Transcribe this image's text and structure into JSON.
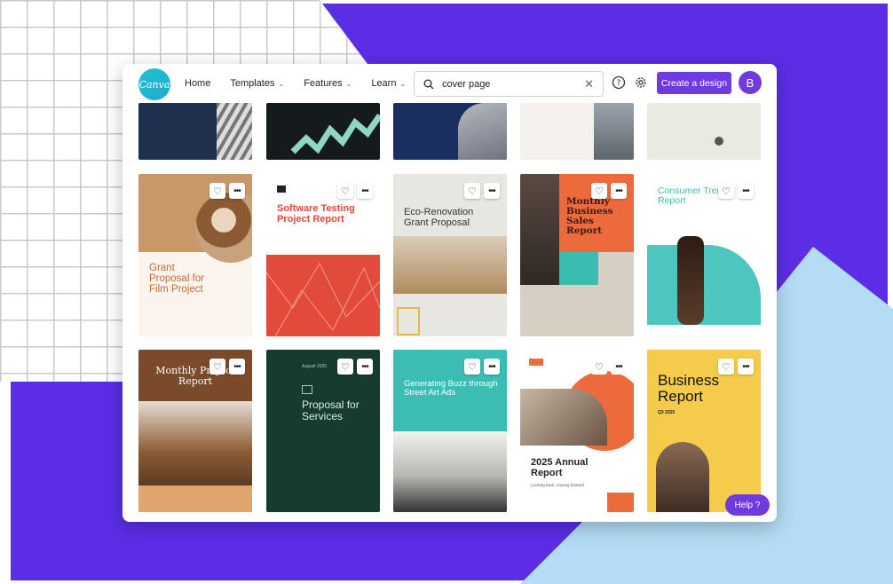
{
  "app": {
    "logo": "Canva"
  },
  "nav": {
    "home": "Home",
    "templates": "Templates",
    "features": "Features",
    "learn": "Learn"
  },
  "search": {
    "value": "cover page"
  },
  "actions": {
    "create": "Create a design",
    "avatar": "B",
    "help_fab": "Help ?"
  },
  "colors": {
    "accent": "#6f3ae0",
    "background_purple": "#5b2ee6",
    "light_blue": "#b4dcf5"
  },
  "icons": [
    "search-icon",
    "close-icon",
    "help-circle-icon",
    "gear-icon",
    "heart-icon",
    "more-icon",
    "chevron-down-icon"
  ],
  "templates": {
    "row2": [
      {
        "title": "Grant Proposal for Film Project"
      },
      {
        "title": "Software Testing Project Report"
      },
      {
        "title": "Eco-Renovation Grant Proposal"
      },
      {
        "title": "Monthly Business Sales Report"
      },
      {
        "title": "Consumer Trends Report"
      }
    ],
    "row3": [
      {
        "title": "Monthly Project Report"
      },
      {
        "title": "Proposal for Services",
        "kicker": "August 2025"
      },
      {
        "title": "Generating Buzz through Street Art Ads"
      },
      {
        "title": "2025 Annual Report",
        "subtitle": "Looking back, moving forward"
      },
      {
        "title": "Business Report",
        "subtitle": "Q3 2025"
      }
    ]
  }
}
